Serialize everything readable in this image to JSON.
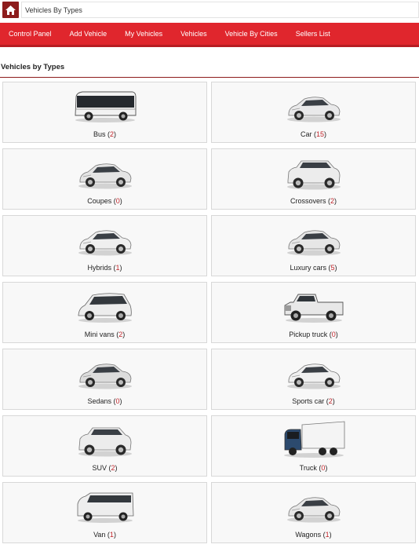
{
  "breadcrumb": {
    "current": "Vehicles By Types"
  },
  "nav": {
    "items": [
      "Control Panel",
      "Add Vehicle",
      "My Vehicles",
      "Vehicles",
      "Vehicle By Cities",
      "Sellers List"
    ]
  },
  "section": {
    "title": "Vehicles by Types"
  },
  "types": [
    {
      "name": "Bus",
      "count": "2",
      "icon": "bus-icon"
    },
    {
      "name": "Car",
      "count": "15",
      "icon": "car-icon"
    },
    {
      "name": "Coupes",
      "count": "0",
      "icon": "coupe-icon"
    },
    {
      "name": "Crossovers",
      "count": "2",
      "icon": "crossover-icon"
    },
    {
      "name": "Hybrids",
      "count": "1",
      "icon": "hybrid-icon"
    },
    {
      "name": "Luxury cars",
      "count": "5",
      "icon": "luxury-car-icon"
    },
    {
      "name": "Mini vans",
      "count": "2",
      "icon": "minivan-icon"
    },
    {
      "name": "Pickup truck",
      "count": "0",
      "icon": "pickup-truck-icon"
    },
    {
      "name": "Sedans",
      "count": "0",
      "icon": "sedan-icon"
    },
    {
      "name": "Sports car",
      "count": "2",
      "icon": "sports-car-icon"
    },
    {
      "name": "SUV",
      "count": "2",
      "icon": "suv-icon"
    },
    {
      "name": "Truck",
      "count": "0",
      "icon": "truck-icon"
    },
    {
      "name": "Van",
      "count": "1",
      "icon": "van-icon"
    },
    {
      "name": "Wagons",
      "count": "1",
      "icon": "wagon-icon"
    }
  ],
  "colors": {
    "brand": "#8d1c1c",
    "nav": "#e0262d",
    "count": "#c0272d"
  }
}
